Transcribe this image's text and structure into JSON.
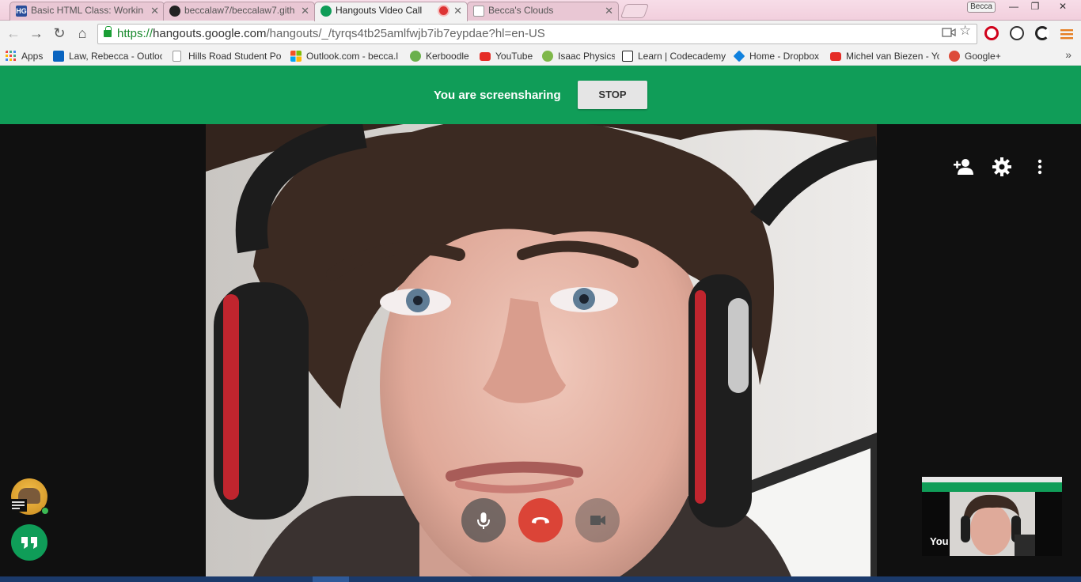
{
  "browser": {
    "tabs": [
      {
        "title": "Basic HTML Class: Workin",
        "favicon": "hg-logo-icon",
        "active": false
      },
      {
        "title": "beccalaw7/beccalaw7.gith",
        "favicon": "github-icon",
        "active": false
      },
      {
        "title": "Hangouts Video Call",
        "favicon": "hangouts-icon",
        "active": true,
        "recording": true
      },
      {
        "title": "Becca's Clouds",
        "favicon": "page-icon",
        "active": false
      }
    ],
    "profile_name": "Becca",
    "window_minimize": "—",
    "window_restore": "❐",
    "window_close": "✕",
    "tab_close": "✕",
    "url_scheme": "https://",
    "url_host": "hangouts.google.com",
    "url_path": "/hangouts/_/tyrqs4tb25amlfwjb7ib7eypdae?hl=en-US",
    "bookmarks": [
      {
        "label": "Apps",
        "icon": "apps-grid-icon",
        "color": "#e44"
      },
      {
        "label": "Law, Rebecca - Outloo",
        "icon": "outlook-icon",
        "color": "#0a64c0"
      },
      {
        "label": "Hills Road Student Po",
        "icon": "page-icon",
        "color": "#ccc"
      },
      {
        "label": "Outlook.com - becca.l",
        "icon": "microsoft-icon",
        "color": "#f35325"
      },
      {
        "label": "Kerboodle",
        "icon": "kerboodle-icon",
        "color": "#6ab04c"
      },
      {
        "label": "YouTube",
        "icon": "youtube-icon",
        "color": "#e52d27"
      },
      {
        "label": "Isaac Physics",
        "icon": "isaac-physics-icon",
        "color": "#7fb84a"
      },
      {
        "label": "Learn | Codecademy",
        "icon": "codecademy-icon",
        "color": "#222"
      },
      {
        "label": "Home - Dropbox",
        "icon": "dropbox-icon",
        "color": "#1081de"
      },
      {
        "label": "Michel van Biezen - Yo",
        "icon": "youtube-icon",
        "color": "#e52d27"
      },
      {
        "label": "Google+",
        "icon": "google-plus-icon",
        "color": "#dd4b39"
      }
    ],
    "bookmarks_more": "»"
  },
  "hangout": {
    "banner_text": "You are screensharing",
    "stop_label": "STOP",
    "self_label": "You",
    "accent_green": "#109d58",
    "hangup_red": "#db4437"
  }
}
